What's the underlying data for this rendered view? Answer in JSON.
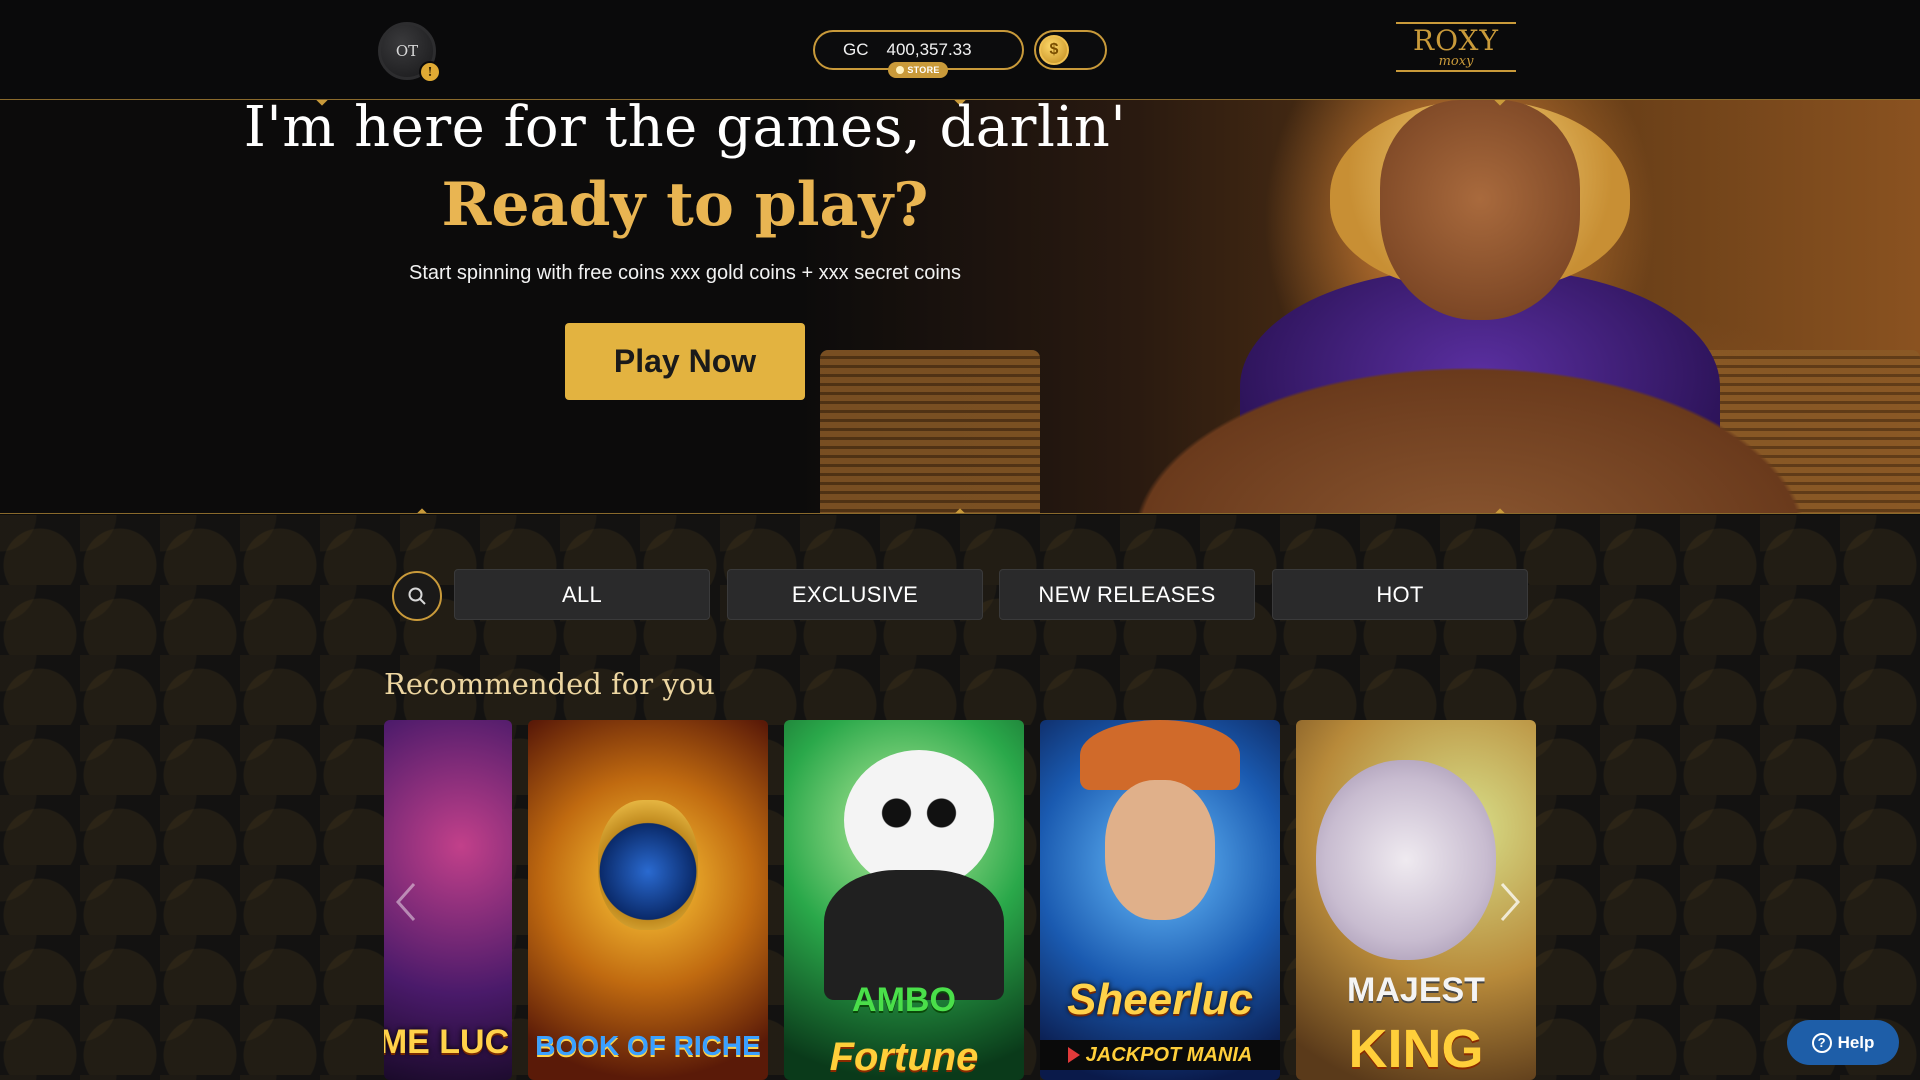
{
  "header": {
    "avatar_initials": "OT",
    "avatar_badge": "!",
    "currency_label": "GC",
    "balance": "400,357.33",
    "store_label": "STORE",
    "logo_main": "ROXY",
    "logo_sub": "moxy"
  },
  "hero": {
    "title": "I'm here for the games, darlin'",
    "subtitle": "Ready to play?",
    "text": "Start spinning with free coins xxx gold coins + xxx secret coins",
    "cta": "Play Now"
  },
  "filters": {
    "tabs": [
      {
        "label": "ALL"
      },
      {
        "label": "EXCLUSIVE"
      },
      {
        "label": "NEW RELEASES"
      },
      {
        "label": "HOT"
      }
    ]
  },
  "recommended": {
    "title": "Recommended for you",
    "games": [
      {
        "title": "ME LUC",
        "subtitle": ""
      },
      {
        "title": "BOOK OF RICHE",
        "subtitle": ""
      },
      {
        "title": "AMBO",
        "subtitle": "Fortune"
      },
      {
        "title": "Sheerluc",
        "subtitle": "JACKPOT MANIA"
      },
      {
        "title": "MAJEST",
        "subtitle": "KING"
      }
    ]
  },
  "help": {
    "label": "Help"
  },
  "colors": {
    "accent": "#c99a3a",
    "cta": "#e3b340",
    "help": "#1e5ea8"
  }
}
